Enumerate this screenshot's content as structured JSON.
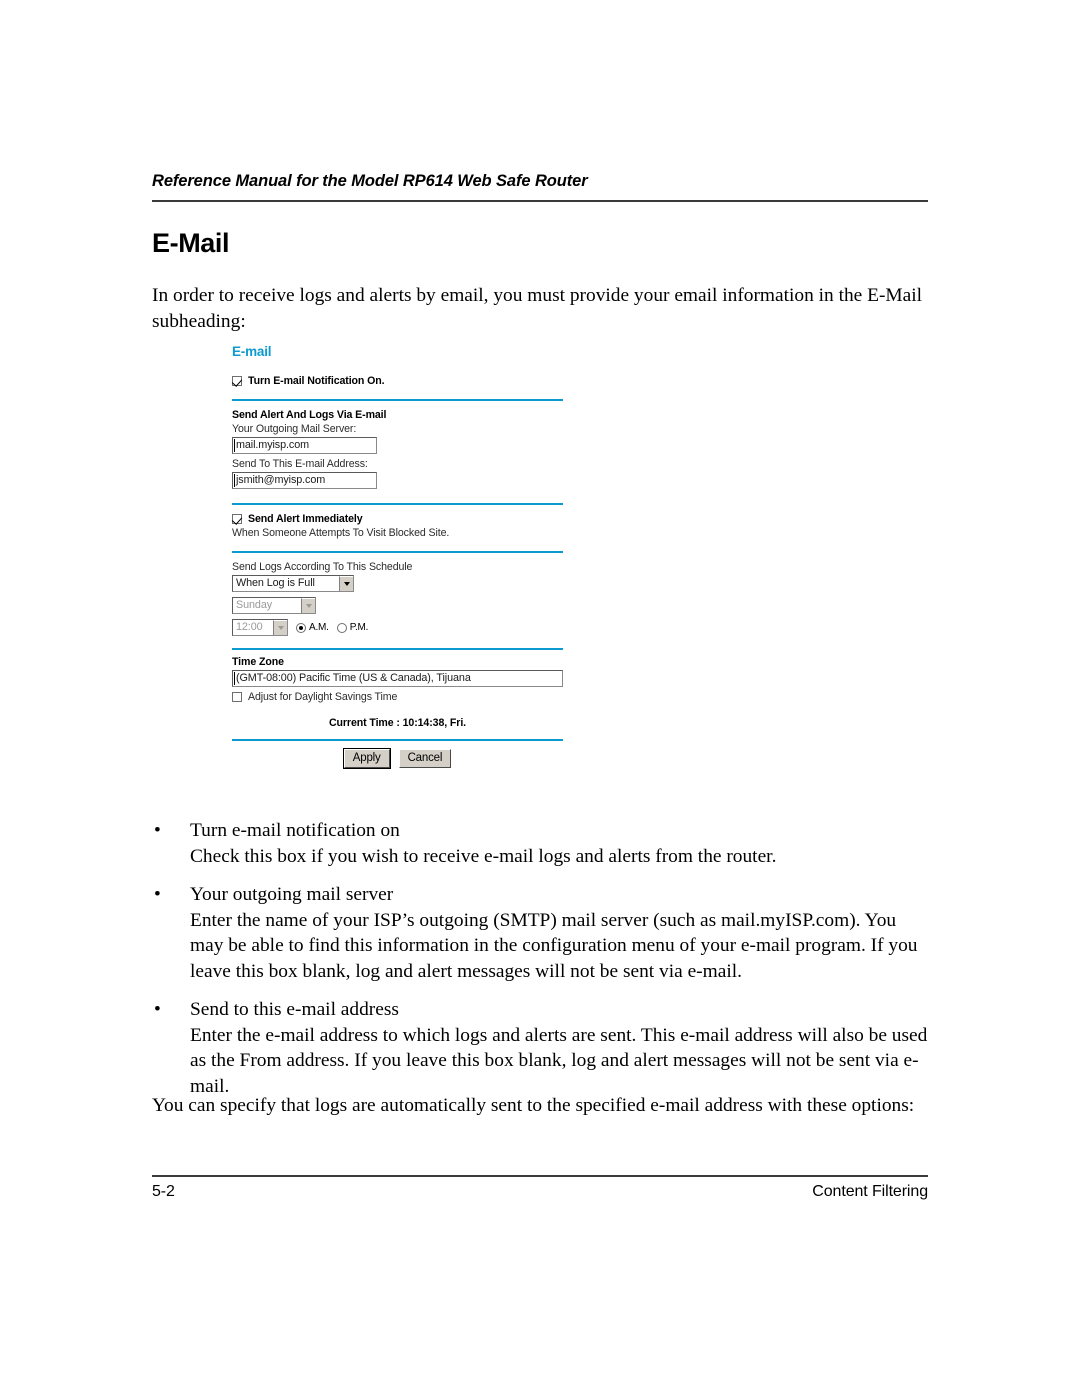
{
  "header": {
    "running_title": "Reference Manual for the Model RP614 Web Safe Router"
  },
  "section": {
    "heading": "E-Mail",
    "intro": "In order to receive logs and alerts by email, you must provide your email information in the E-Mail subheading:"
  },
  "colors": {
    "accent_teal": "#0c9bd0",
    "rule_gray": "#3a3a3a",
    "button_face": "#d4d0c8"
  },
  "router_ui": {
    "title": "E-mail",
    "notification": {
      "label": "Turn E-mail Notification On.",
      "checked": true
    },
    "send_alert_section": {
      "heading": "Send Alert And Logs Via E-mail",
      "outgoing_label": "Your Outgoing Mail Server:",
      "outgoing_value": "mail.myisp.com",
      "recipient_label": "Send To This E-mail Address:",
      "recipient_value": "jsmith@myisp.com"
    },
    "alert_immediately": {
      "label": "Send Alert Immediately",
      "checked": true,
      "sublabel": "When Someone Attempts To Visit Blocked Site."
    },
    "schedule": {
      "label": "Send Logs According To This Schedule",
      "frequency_value": "When Log is Full",
      "day_value": "Sunday",
      "day_disabled": true,
      "time_value": "12:00",
      "time_disabled": true,
      "am_label": "A.M.",
      "pm_label": "P.M.",
      "meridiem_selected": "A.M."
    },
    "time_zone": {
      "heading": "Time Zone",
      "value": "(GMT-08:00) Pacific Time (US & Canada), Tijuana",
      "dst_label": "Adjust for Daylight Savings Time",
      "dst_checked": false
    },
    "current_time": "Current Time : 10:14:38, Fri.",
    "buttons": {
      "apply": "Apply",
      "cancel": "Cancel"
    }
  },
  "bullets": [
    {
      "term": "Turn e-mail notification on",
      "desc": "Check this box if you wish to receive e-mail logs and alerts from the router."
    },
    {
      "term": "Your outgoing mail server",
      "desc": "Enter the name of your ISP’s outgoing (SMTP) mail server (such as mail.myISP.com). You may be able to find this information in the configuration menu of your e-mail program. If you leave this box blank, log and alert messages will not be sent via e-mail."
    },
    {
      "term": "Send to this e-mail address",
      "desc": "Enter the e-mail address to which logs and alerts are sent. This e-mail address will also be used as the From address. If you leave this box blank, log and alert messages will not be sent via e-mail."
    }
  ],
  "closing_paragraph": "You can specify that logs are automatically sent to the specified e-mail address with these options:",
  "footer": {
    "page_number": "5-2",
    "chapter": "Content Filtering"
  }
}
